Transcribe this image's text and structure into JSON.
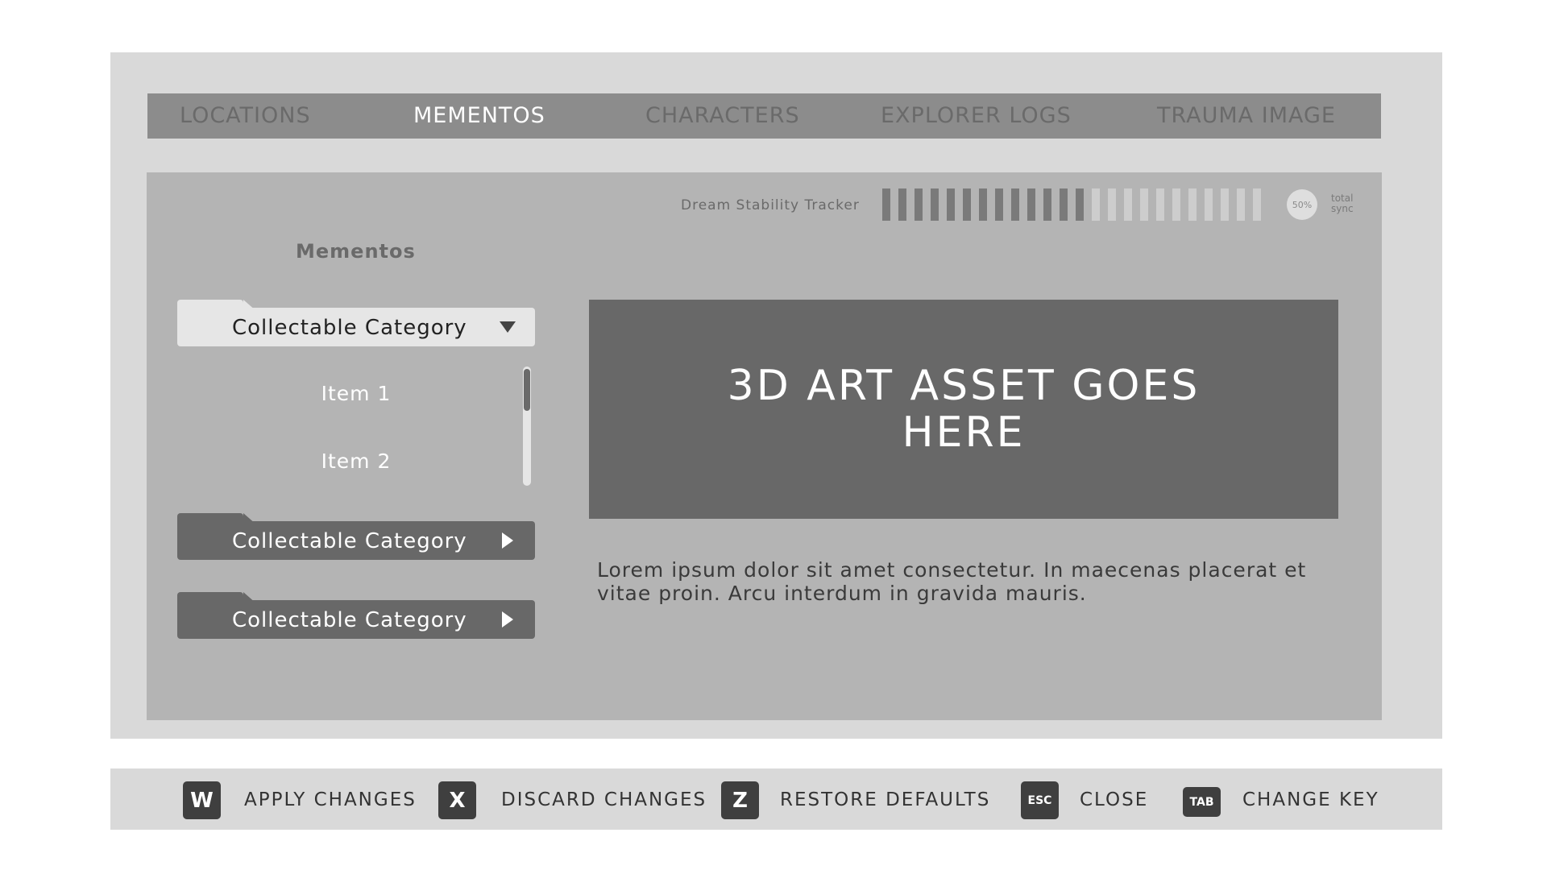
{
  "nav": {
    "tabs": [
      {
        "label": "LOCATIONS",
        "active": false
      },
      {
        "label": "MEMENTOS",
        "active": true
      },
      {
        "label": "CHARACTERS",
        "active": false
      },
      {
        "label": "EXPLORER LOGS",
        "active": false
      },
      {
        "label": "TRAUMA IMAGE",
        "active": false
      }
    ]
  },
  "tracker": {
    "label": "Dream Stability Tracker",
    "segments_total": 24,
    "segments_filled": 13,
    "percent_label": "50%",
    "sync_label": "total sync",
    "colors": {
      "filled": "#7a7a7a",
      "empty": "#cdcdcd"
    }
  },
  "sidebar": {
    "title": "Mementos",
    "categories": [
      {
        "label": "Collectable Category",
        "expanded": true,
        "arrow_icon": "triangle-down-icon"
      },
      {
        "label": "Collectable Category",
        "expanded": false,
        "arrow_icon": "triangle-right-icon"
      },
      {
        "label": "Collectable Category",
        "expanded": false,
        "arrow_icon": "triangle-right-icon"
      }
    ],
    "items": [
      "Item 1",
      "Item 2"
    ]
  },
  "main": {
    "asset_placeholder": "3D ART ASSET GOES HERE",
    "description": "Lorem ipsum dolor sit amet consectetur. In maecenas placerat et vitae proin. Arcu interdum in gravida mauris."
  },
  "footer": {
    "actions": [
      {
        "key": "W",
        "label": "APPLY CHANGES"
      },
      {
        "key": "X",
        "label": "DISCARD CHANGES"
      },
      {
        "key": "Z",
        "label": "RESTORE DEFAULTS"
      },
      {
        "key": "ESC",
        "label": "CLOSE"
      },
      {
        "key": "TAB",
        "label": "CHANGE KEY"
      }
    ]
  }
}
